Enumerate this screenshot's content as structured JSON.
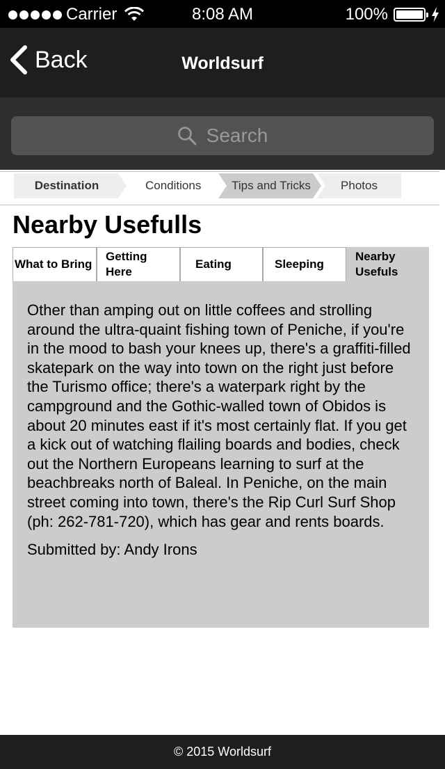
{
  "status_bar": {
    "carrier": "Carrier",
    "time": "8:08 AM",
    "battery": "100%",
    "battery_level": 1.0
  },
  "nav": {
    "back_label": "Back",
    "title": "Worldsurf"
  },
  "search": {
    "placeholder": "Search"
  },
  "steps": [
    {
      "label": "Destination",
      "state": "current"
    },
    {
      "label": "Conditions",
      "state": "default"
    },
    {
      "label": "Tips and Tricks",
      "state": "selected"
    },
    {
      "label": "Photos",
      "state": "default"
    }
  ],
  "page_title": "Nearby Usefulls",
  "tabs": [
    {
      "label": "What to Bring"
    },
    {
      "label": "Getting Here"
    },
    {
      "label": "Eating"
    },
    {
      "label": "Sleeping"
    },
    {
      "label": "Nearby Usefuls",
      "active": true
    }
  ],
  "content": {
    "body": "Other than amping out on little coffees and strolling around the ultra-quaint fishing town of Peniche, if you're in the mood to bash your knees up, there's a graffiti-filled skatepark on the way into town on the right just before the Turismo office; there's a waterpark right by the campground and the Gothic-walled town of Obidos is about 20 minutes east if it's most certainly flat. If you get a kick out of watching flailing boards and bodies, check out the Northern Europeans learning to surf at the beachbreaks north of Baleal. In Peniche, on the main street coming into town, there's the Rip Curl Surf Shop (ph: 262-781-720), which has gear and rents boards.",
    "submitted_by": "Submitted by: Andy Irons"
  },
  "footer": {
    "copyright": "© 2015 Worldsurf"
  },
  "colors": {
    "nav_bg": "#1f1e1e",
    "search_bg": "#2f2e2e",
    "search_field": "#525252",
    "content_bg": "#cccccc",
    "step_bg": "#eeeeee",
    "step_selected_bg": "#cccccc"
  }
}
